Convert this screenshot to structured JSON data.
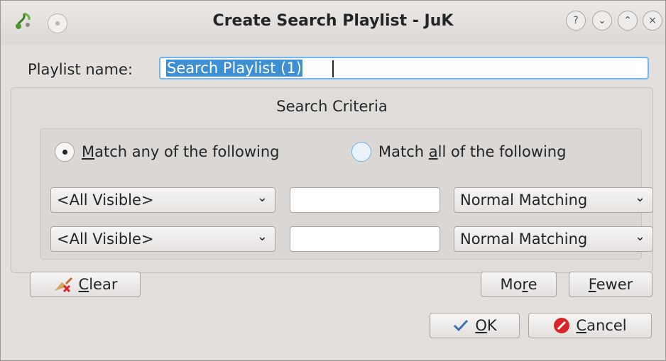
{
  "window": {
    "title": "Create Search Playlist - JuK"
  },
  "titlebar_buttons": [
    {
      "icon": "help-icon",
      "glyph": "?"
    },
    {
      "icon": "minimize-icon",
      "glyph": "⌄"
    },
    {
      "icon": "maximize-icon",
      "glyph": "⌃"
    },
    {
      "icon": "close-icon",
      "glyph": "×"
    }
  ],
  "playlist_name": {
    "label": "Playlist name:",
    "value": "Search Playlist (1)"
  },
  "search_criteria": {
    "title": "Search Criteria",
    "match_any": {
      "pre": "",
      "mnemonic": "M",
      "post": "atch any of the following",
      "checked": true
    },
    "match_all": {
      "pre": "Match ",
      "mnemonic": "a",
      "post": "ll of the following",
      "checked": false
    },
    "rows": [
      {
        "field": "<All Visible>",
        "text": "",
        "mode": "Normal Matching"
      },
      {
        "field": "<All Visible>",
        "text": "",
        "mode": "Normal Matching"
      }
    ]
  },
  "buttons": {
    "clear": {
      "pre": "",
      "mnemonic": "C",
      "post": "lear",
      "icon": "broom-icon"
    },
    "more": {
      "pre": "Mo",
      "mnemonic": "r",
      "post": "e"
    },
    "fewer": {
      "pre": "",
      "mnemonic": "F",
      "post": "ewer"
    },
    "ok": {
      "pre": "",
      "mnemonic": "O",
      "post": "K",
      "icon": "checkmark-icon"
    },
    "cancel": {
      "pre": "",
      "mnemonic": "C",
      "post": "ancel",
      "icon": "cancel-icon"
    }
  },
  "colors": {
    "selection": "#3d8fd1",
    "focus": "#6fb4ea",
    "cancel_red": "#d9262b"
  }
}
